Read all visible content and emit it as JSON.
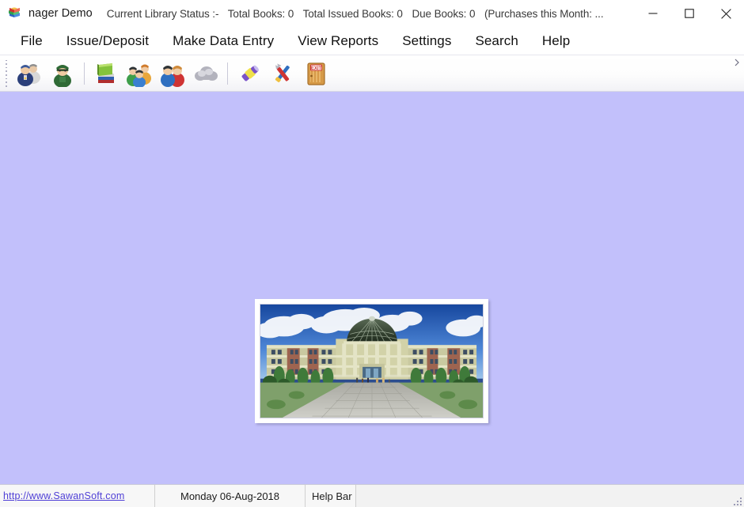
{
  "window": {
    "app_icon": "books-icon",
    "title": "nager Demo",
    "status_prefix": "Current Library Status :-",
    "status_items": [
      "Total Books: 0",
      "Total Issued Books: 0",
      "Due Books: 0",
      "(Purchases this Month: ..."
    ],
    "controls": {
      "minimize": "minimize-icon",
      "maximize": "maximize-icon",
      "close": "close-icon"
    }
  },
  "menubar": {
    "items": [
      {
        "label": "File",
        "name": "menu-file"
      },
      {
        "label": "Issue/Deposit",
        "name": "menu-issue-deposit"
      },
      {
        "label": "Make Data Entry",
        "name": "menu-make-data-entry"
      },
      {
        "label": "View Reports",
        "name": "menu-view-reports"
      },
      {
        "label": "Settings",
        "name": "menu-settings"
      },
      {
        "label": "Search",
        "name": "menu-search"
      },
      {
        "label": "Help",
        "name": "menu-help"
      }
    ]
  },
  "toolbar": {
    "grip": "toolbar-drag-grip",
    "overflow": "toolbar-overflow-chevron",
    "buttons": [
      {
        "name": "toolbar-staff-icon",
        "icon": "staff-group-icon"
      },
      {
        "name": "toolbar-officer-icon",
        "icon": "officer-icon"
      },
      {
        "name": "toolbar-books-icon",
        "icon": "book-stack-icon"
      },
      {
        "name": "toolbar-members-icon",
        "icon": "members-group-icon"
      },
      {
        "name": "toolbar-users-icon",
        "icon": "users-pair-icon"
      },
      {
        "name": "toolbar-cloud-icon",
        "icon": "cloud-icon"
      },
      {
        "name": "toolbar-torch-icon",
        "icon": "torch-icon"
      },
      {
        "name": "toolbar-tools-icon",
        "icon": "tools-icon"
      },
      {
        "name": "toolbar-exit-icon",
        "icon": "exit-door-icon"
      }
    ]
  },
  "client": {
    "hero_image": "library-building-photo"
  },
  "statusbar": {
    "website": "http://www.SawanSoft.com",
    "date": "Monday 06-Aug-2018",
    "help": "Help Bar",
    "resize_grip": "resize-grip-icon"
  },
  "colors": {
    "client_background": "#c2c0fb",
    "titlebar_background": "#ffffff",
    "link": "#4f3fd6",
    "statusbar_background": "#f2f2f2"
  }
}
